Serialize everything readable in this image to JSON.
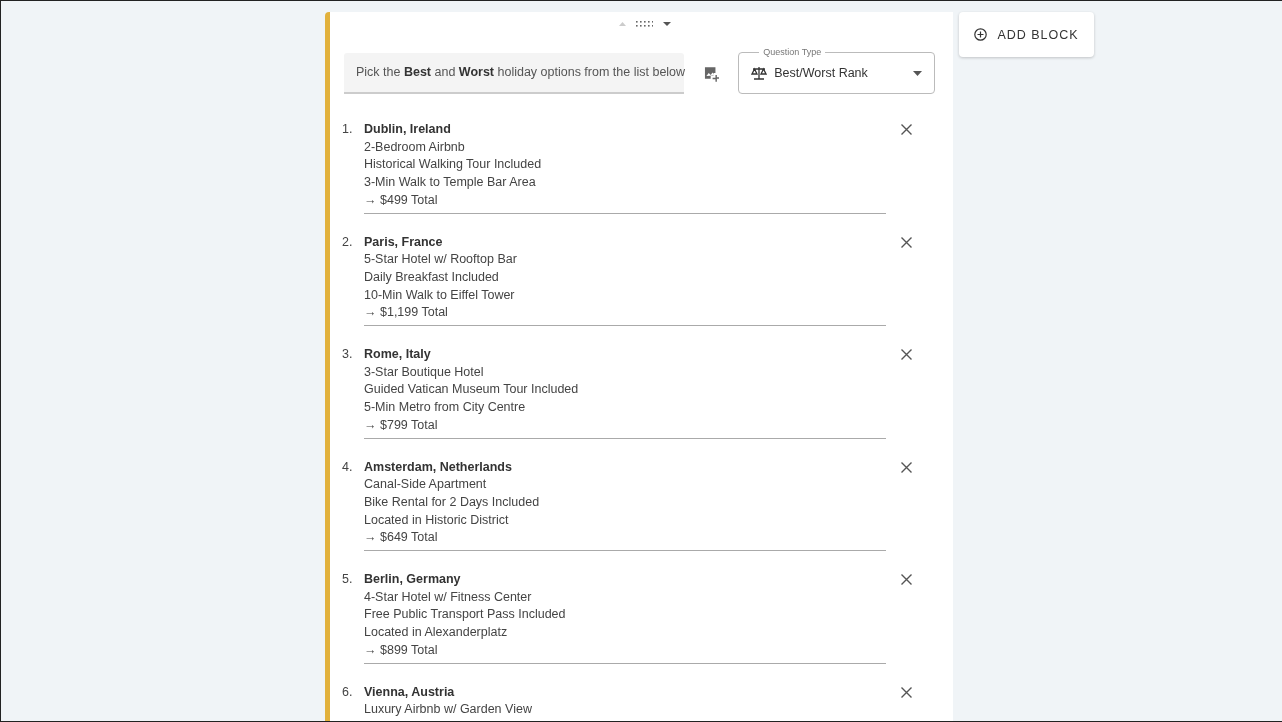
{
  "question": {
    "text": "Pick the **Best** and **Worst** holiday options from the list below"
  },
  "question_type": {
    "label": "Question Type",
    "value": "Best/Worst Rank"
  },
  "options": [
    {
      "number": "1.",
      "title": "Dublin, Ireland",
      "lines": [
        "2-Bedroom Airbnb",
        "Historical Walking Tour Included",
        "3-Min Walk to Temple Bar Area",
        "→ $499 Total"
      ]
    },
    {
      "number": "2.",
      "title": "Paris, France",
      "lines": [
        "5-Star Hotel w/ Rooftop Bar",
        "Daily Breakfast Included",
        "10-Min Walk to Eiffel Tower",
        "→ $1,199 Total"
      ]
    },
    {
      "number": "3.",
      "title": "Rome, Italy",
      "lines": [
        "3-Star Boutique Hotel",
        "Guided Vatican Museum Tour Included",
        "5-Min Metro from City Centre",
        "→ $799 Total"
      ]
    },
    {
      "number": "4.",
      "title": "Amsterdam, Netherlands",
      "lines": [
        "Canal-Side Apartment",
        "Bike Rental for 2 Days Included",
        "Located in Historic District",
        "→ $649 Total"
      ]
    },
    {
      "number": "5.",
      "title": "Berlin, Germany",
      "lines": [
        "4-Star Hotel w/ Fitness Center",
        "Free Public Transport Pass Included",
        "Located in Alexanderplatz",
        "→ $899 Total"
      ]
    },
    {
      "number": "6.",
      "title": "Vienna, Austria",
      "lines": [
        "Luxury Airbnb w/ Garden View"
      ]
    }
  ],
  "add_block": {
    "label": "ADD BLOCK"
  }
}
